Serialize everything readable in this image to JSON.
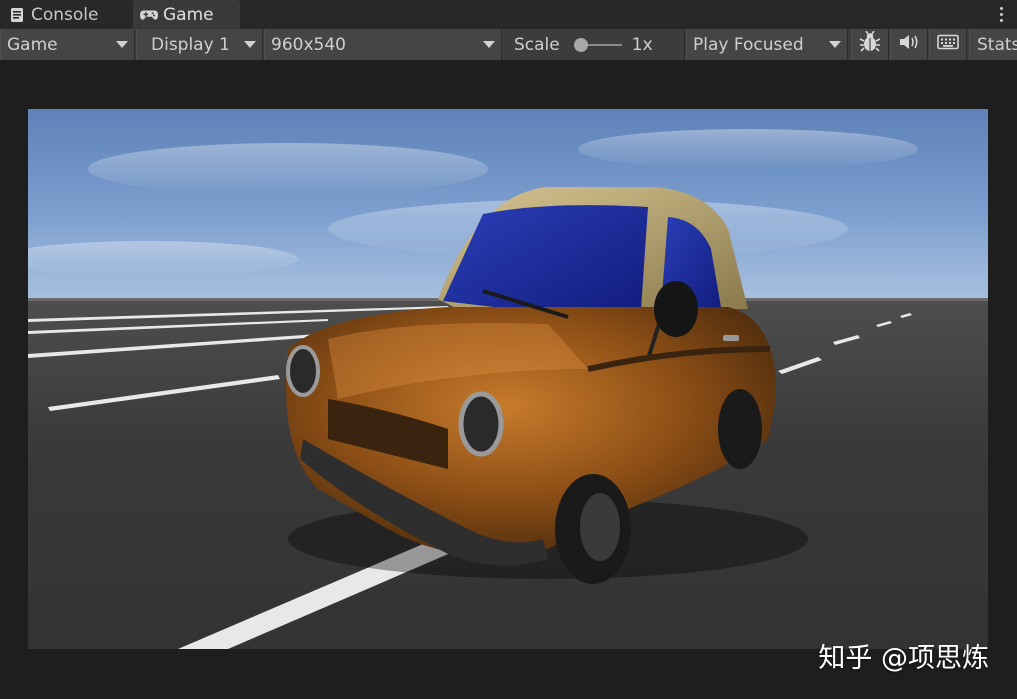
{
  "tabs": [
    {
      "label": "Console",
      "icon": "console-icon"
    },
    {
      "label": "Game",
      "icon": "gamepad-icon"
    }
  ],
  "toolbar": {
    "view_mode": "Game",
    "display": "Display 1",
    "resolution": "960x540",
    "scale_label": "Scale",
    "scale_value": "1x",
    "play_mode": "Play Focused",
    "stats_label": "Stats"
  },
  "icons": {
    "bug": "bug-icon",
    "audio": "audio-icon",
    "keyboard": "keyboard-icon"
  },
  "watermark": "知乎 @项思炼",
  "colors": {
    "tab_active_bg": "#3a3a3a",
    "toolbar_bg": "#3c3c3c",
    "panel_bg": "#1e1e1e",
    "sky_top": "#5e82b8",
    "car_body": "#9a5a1a"
  }
}
